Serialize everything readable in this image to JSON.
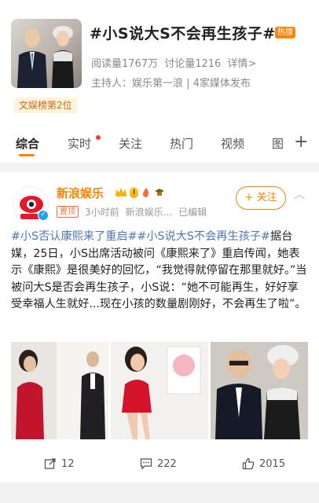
{
  "topic": {
    "title": "#小S说大S不会再生孩子#",
    "hot_badge": "热搜",
    "read_count": "阅读量1767万",
    "discuss_count": "讨论量1216",
    "details_link": "详情>",
    "host": "主持人：娱乐第一浪 | 4家媒体发布",
    "rank_tag": "文娱榜第2位"
  },
  "tabs": [
    {
      "label": "综合"
    },
    {
      "label": "实时"
    },
    {
      "label": "关注"
    },
    {
      "label": "热门"
    },
    {
      "label": "视频"
    },
    {
      "label": "图"
    }
  ],
  "tabs_more": "+",
  "post": {
    "author": "新浪娱乐",
    "vip_level": "I",
    "pin_label": "置顶",
    "time": "3小时前",
    "source": "新浪娱乐...",
    "edited": "已编辑",
    "follow_label": "+ 关注",
    "hashtags": "#小S否认康熙来了重启##小S说大S不会再生孩子#",
    "body": "据台媒，25日，小S出席活动被问《康熙来了》重启传闻，她表示《康熙》是很美好的回忆，“我觉得就停留在那里就好。”当被问大S是否会再生孩子，小S说：“她不可能再生，好好享受幸福人生就好...现在小孩的数量剧刚好，不会再生了啦”。",
    "stats": {
      "reposts": "12",
      "comments": "222",
      "likes": "2015"
    }
  },
  "colors": {
    "accent": "#ff8200",
    "link": "#4a78b5"
  }
}
